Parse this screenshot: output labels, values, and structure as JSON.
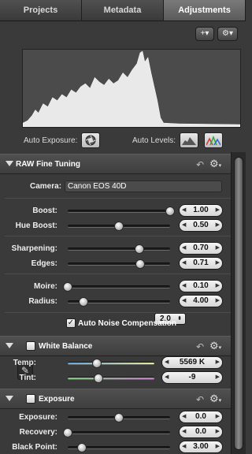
{
  "tabs": [
    {
      "label": "Projects",
      "active": false
    },
    {
      "label": "Metadata",
      "active": false
    },
    {
      "label": "Adjustments",
      "active": true
    }
  ],
  "toolbar": {
    "add_symbol": "+▾",
    "gear_symbol": "⚙▾"
  },
  "auto": {
    "auto_exposure_label": "Auto Exposure:",
    "auto_levels_label": "Auto Levels:"
  },
  "raw": {
    "title": "RAW Fine Tuning",
    "preset": "2.0",
    "camera_label": "Camera:",
    "camera_value": "Canon EOS 40D",
    "sliders": [
      {
        "label": "Boost:",
        "value": "1.00",
        "fraction": 1.0
      },
      {
        "label": "Hue Boost:",
        "value": "0.50",
        "fraction": 0.5
      },
      {
        "label": "Sharpening:",
        "value": "0.70",
        "fraction": 0.7
      },
      {
        "label": "Edges:",
        "value": "0.71",
        "fraction": 0.71
      },
      {
        "label": "Moire:",
        "value": "0.10",
        "fraction": 0.0
      },
      {
        "label": "Radius:",
        "value": "4.00",
        "fraction": 0.15
      }
    ],
    "noise_label": "Auto Noise Compensation",
    "noise_checked": true
  },
  "white_balance": {
    "title": "White Balance",
    "temp_label": "Temp:",
    "temp_value": "5569 K",
    "temp_fraction": 0.34,
    "tint_label": "Tint:",
    "tint_value": "-9",
    "tint_fraction": 0.35
  },
  "exposure": {
    "title": "Exposure",
    "sliders": [
      {
        "label": "Exposure:",
        "value": "0.0",
        "fraction": 0.5
      },
      {
        "label": "Recovery:",
        "value": "0.0",
        "fraction": 0.0
      },
      {
        "label": "Black Point:",
        "value": "3.00",
        "fraction": 0.14
      }
    ]
  }
}
